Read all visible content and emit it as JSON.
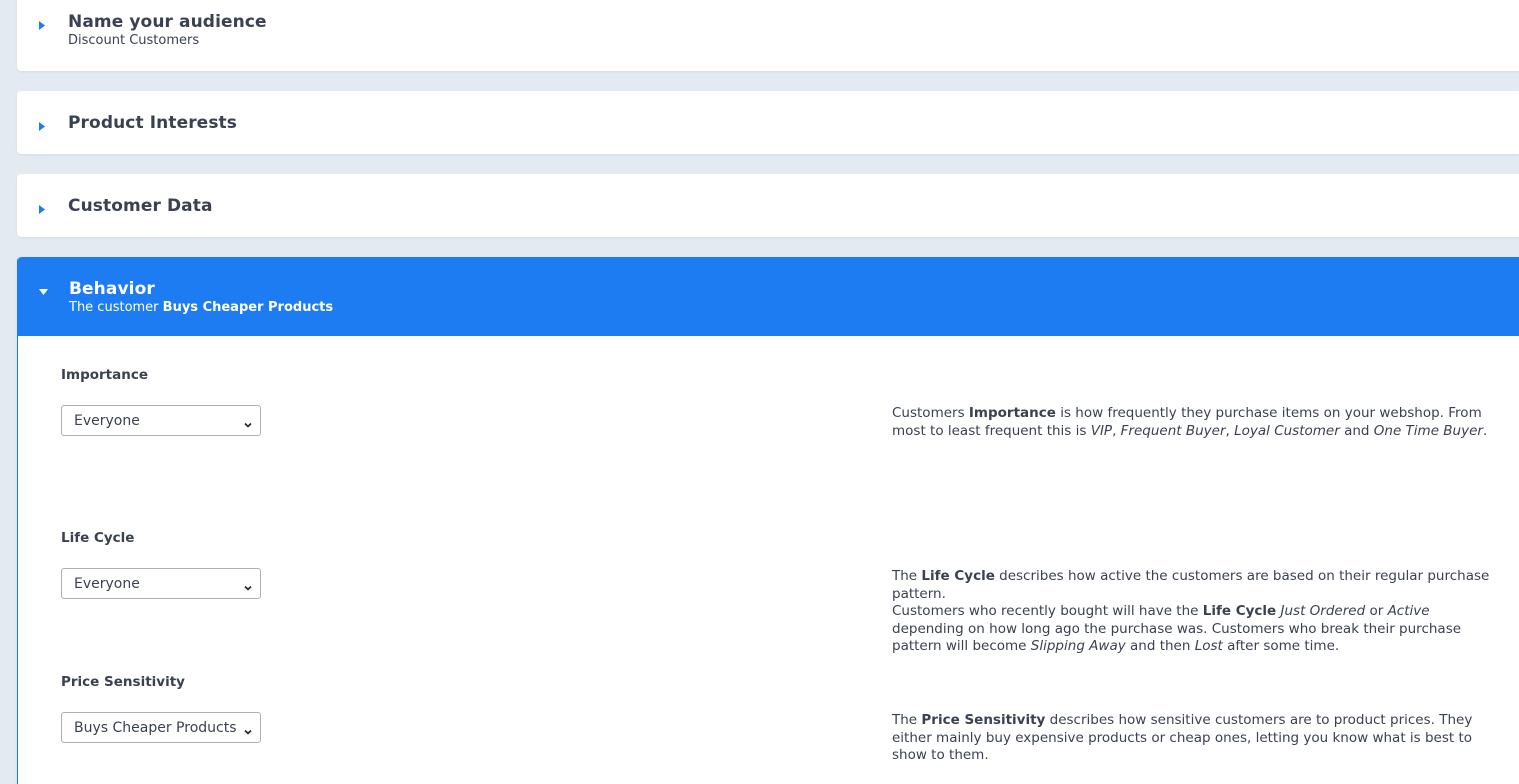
{
  "accent_color": "#1e7cf2",
  "sections": [
    {
      "title": "Name your audience",
      "subtitle": "Discount Customers",
      "expanded": false
    },
    {
      "title": "Product Interests",
      "expanded": false
    },
    {
      "title": "Customer Data",
      "expanded": false
    },
    {
      "title": "Behavior",
      "subtitle_prefix": "The customer ",
      "subtitle_value": "Buys Cheaper Products",
      "expanded": true
    }
  ],
  "fields": {
    "importance": {
      "label": "Importance",
      "value": "Everyone",
      "help": {
        "t1": "Customers ",
        "b1": "Importance",
        "t2": " is how frequently they purchase items on your webshop. From most to least frequent this is ",
        "i1": "VIP",
        "t3": ", ",
        "i2": "Frequent Buyer",
        "t4": ", ",
        "i3": "Loyal Customer",
        "t5": " and ",
        "i4": "One Time Buyer",
        "t6": "."
      }
    },
    "life_cycle": {
      "label": "Life Cycle",
      "value": "Everyone",
      "help": {
        "t1": "The ",
        "b1": "Life Cycle",
        "t2": " describes how active the customers are based on their regular purchase pattern.",
        "t3": "Customers who recently bought will have the ",
        "b2": "Life Cycle",
        "t4": " ",
        "i1": "Just Ordered",
        "t5": " or ",
        "i2": "Active",
        "t6": " depending on how long ago the purchase was. Customers who break their purchase pattern will become ",
        "i3": "Slipping Away",
        "t7": " and then ",
        "i4": "Lost",
        "t8": " after some time."
      }
    },
    "price_sensitivity": {
      "label": "Price Sensitivity",
      "value": "Buys Cheaper Products",
      "help": {
        "t1": "The ",
        "b1": "Price Sensitivity",
        "t2": " describes how sensitive customers are to product prices. They either mainly buy expensive products or cheap ones, letting you know what is best to show to them."
      }
    }
  }
}
